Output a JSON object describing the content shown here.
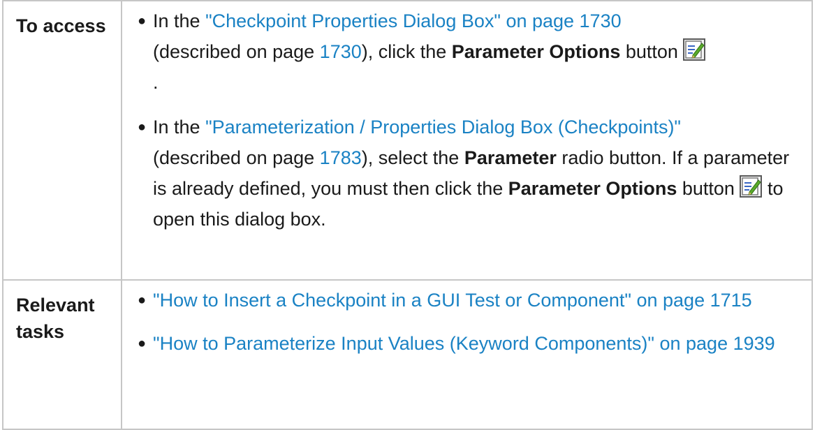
{
  "table": {
    "row_access": {
      "label": "To access",
      "items": [
        {
          "prefix": "In the ",
          "link": "\"Checkpoint Properties Dialog Box\" on page 1730",
          "mid1": " (described on page ",
          "page_link": "1730",
          "mid2": "), click the ",
          "bold": "Parameter Options",
          "suffix": " button",
          "after_icon": " ."
        },
        {
          "prefix": "In the ",
          "link": "\"Parameterization / Properties Dialog Box (Checkpoints)\"",
          "mid1": " (described on page ",
          "page_link": "1783",
          "mid2": "), select the ",
          "bold": "Parameter",
          "mid3": " radio button. If a parameter is already defined, you must then click the ",
          "bold2": "Parameter Options",
          "suffix": " button",
          "after_icon": " to open this dialog box."
        }
      ]
    },
    "row_tasks": {
      "label": "Relevant tasks",
      "items": [
        {
          "link": "\"How to Insert a Checkpoint in a GUI Test or Component\" on page 1715"
        },
        {
          "link": "\"How to Parameterize Input Values (Keyword Components)\" on page 1939"
        }
      ]
    }
  },
  "icons": {
    "button_icon": "edit-parameter-icon"
  },
  "colors": {
    "link": "#1a82c4",
    "border": "#c6c6c6"
  }
}
